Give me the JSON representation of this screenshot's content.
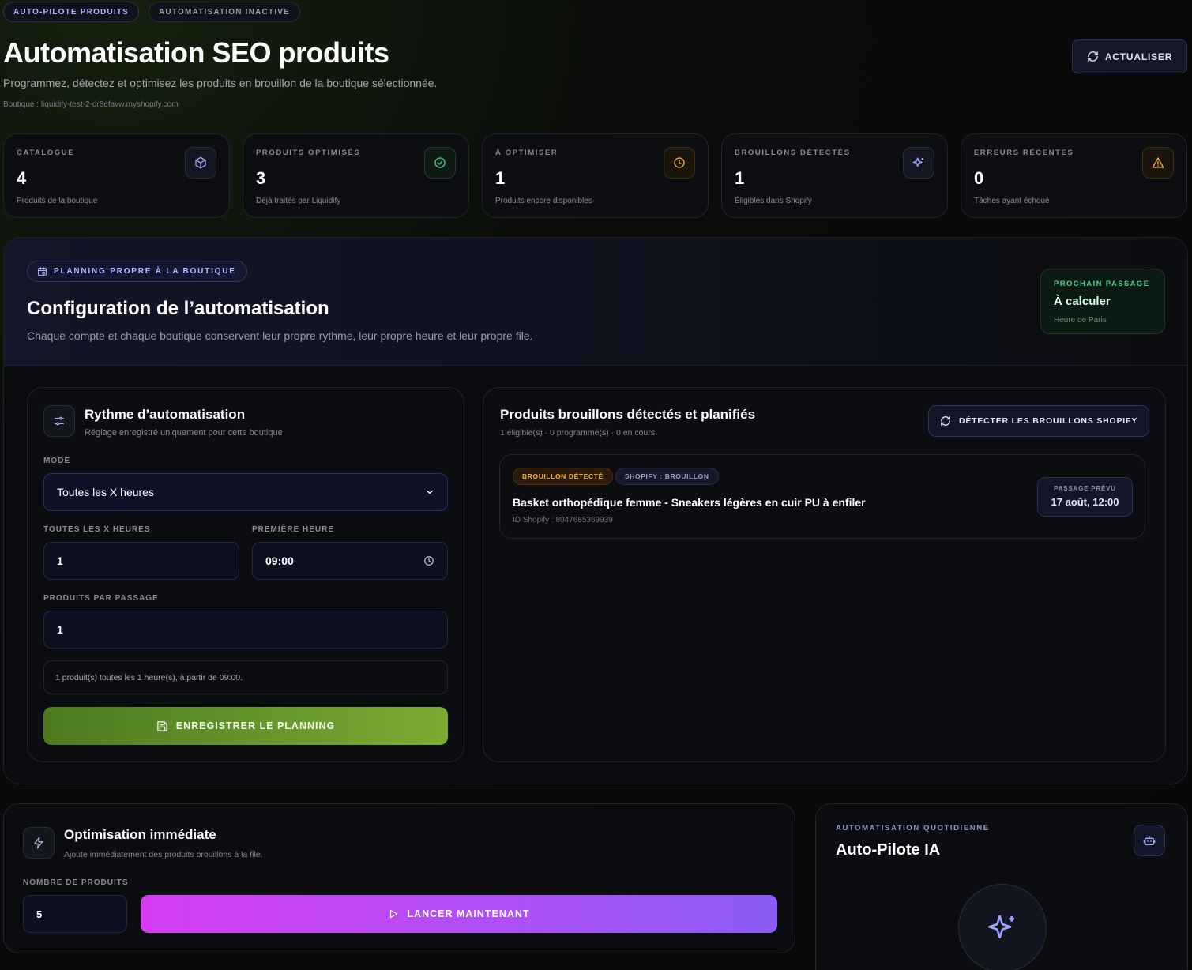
{
  "header": {
    "pill_autopilot": "AUTO-PILOTE PRODUITS",
    "pill_status": "AUTOMATISATION INACTIVE",
    "title": "Automatisation SEO produits",
    "subtitle": "Programmez, détectez et optimisez les produits en brouillon de la boutique sélectionnée.",
    "shop": "Boutique : liquidify-test-2-dr8efavw.myshopify.com",
    "refresh_label": "ACTUALISER"
  },
  "stats": [
    {
      "label": "CATALOGUE",
      "value": "4",
      "desc": "Produits de la boutique",
      "icon": "cube-icon",
      "color": "#9aa6ff"
    },
    {
      "label": "PRODUITS OPTIMISÉS",
      "value": "3",
      "desc": "Déjà traités par Liquidify",
      "icon": "check-circle-icon",
      "color": "#3fd38a"
    },
    {
      "label": "À OPTIMISER",
      "value": "1",
      "desc": "Produits encore disponibles",
      "icon": "clock-icon",
      "color": "#f2b13c"
    },
    {
      "label": "BROUILLONS DÉTECTÉS",
      "value": "1",
      "desc": "Éligibles dans Shopify",
      "icon": "sparkles-icon",
      "color": "#9aa6ff"
    },
    {
      "label": "ERREURS RÉCENTES",
      "value": "0",
      "desc": "Tâches ayant échoué",
      "icon": "warning-icon",
      "color": "#f2b13c"
    }
  ],
  "config": {
    "tag": "PLANNING PROPRE À LA BOUTIQUE",
    "title": "Configuration de l’automatisation",
    "subtitle": "Chaque compte et chaque boutique conservent leur propre rythme, leur propre heure et leur propre file.",
    "next_label": "PROCHAIN PASSAGE",
    "next_value": "À calculer",
    "next_tz": "Heure de Paris"
  },
  "rhythm": {
    "title": "Rythme d’automatisation",
    "subtitle": "Réglage enregistré uniquement pour cette boutique",
    "mode_label": "MODE",
    "mode_value": "Toutes les X heures",
    "every_label": "TOUTES LES X HEURES",
    "every_value": "1",
    "first_label": "PREMIÈRE HEURE",
    "first_value": "09:00",
    "per_pass_label": "PRODUITS PAR PASSAGE",
    "per_pass_value": "1",
    "summary": "1 produit(s) toutes les 1 heure(s), à partir de 09:00.",
    "save_label": "ENREGISTRER LE PLANNING"
  },
  "drafts": {
    "title": "Produits brouillons détectés et planifiés",
    "counts": "1 éligible(s) · 0 programmé(s) · 0 en cours",
    "detect_label": "DÉTECTER LES BROUILLONS SHOPIFY",
    "items": [
      {
        "badge_detected": "BROUILLON DÉTECTÉ",
        "badge_shopify": "SHOPIFY : BROUILLON",
        "name": "Basket orthopédique femme - Sneakers légères en cuir PU à enfiler",
        "id": "ID Shopify : 8047685369939",
        "planned_label": "PASSAGE PRÉVU",
        "planned_value": "17 août, 12:00"
      }
    ]
  },
  "immediate": {
    "title": "Optimisation immédiate",
    "subtitle": "Ajoute immédiatement des produits brouillons à la file.",
    "count_label": "NOMBRE DE PRODUITS",
    "count_value": "5",
    "launch_label": "LANCER MAINTENANT"
  },
  "autopilot": {
    "label": "AUTOMATISATION QUOTIDIENNE",
    "title": "Auto-Pilote IA"
  }
}
